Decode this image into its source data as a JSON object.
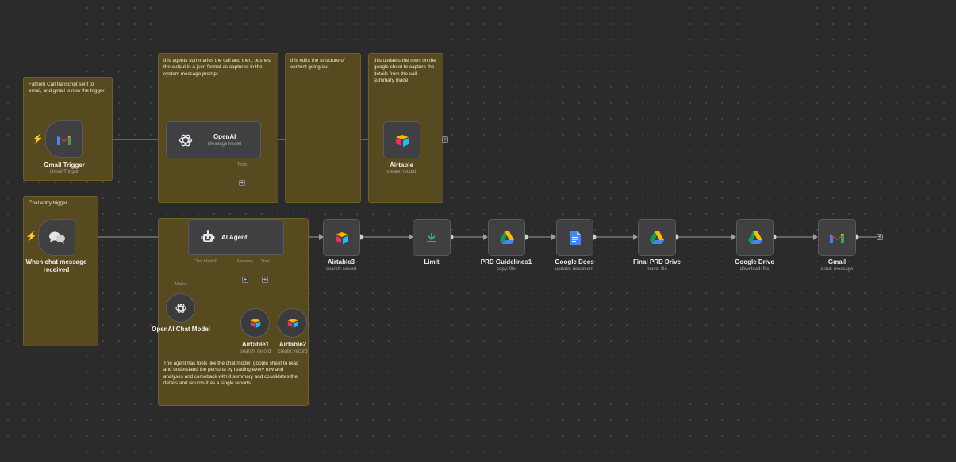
{
  "notes": {
    "fathom": "Fathom Call transcript sent to email, and gmail is now the trigger",
    "summarize": "this agents summaries the call and then, pushes the output in a json format as captured in the system message prompt",
    "edits": "this edits the structure of content going out",
    "updates": "this updates the rows on the google sheet to capture the details from the call summary made",
    "chat_entry": "Chat entry trigger",
    "agent_tools": "The agent has tools like the chat model, google sheet to read and understand the persona by reading every row and analyses and comeback with it summary and cosolidates the details and returns it as a single reports"
  },
  "nodes": {
    "gmail_trigger": {
      "title": "Gmail Trigger",
      "sub": "Gmail Trigger"
    },
    "openai": {
      "title": "OpenAI",
      "sub": "Message Model",
      "tools": "Tools"
    },
    "airtable": {
      "title": "Airtable",
      "sub": "create: record"
    },
    "chat_trigger": {
      "title": "When chat message received"
    },
    "ai_agent": {
      "title": "AI Agent",
      "chat_model": "Chat Model*",
      "memory": "Memory",
      "tool": "Tool"
    },
    "openai_chat": {
      "title": "OpenAI Chat Model",
      "model_label": "Model"
    },
    "airtable1": {
      "title": "Airtable1",
      "sub": "search: record"
    },
    "airtable2": {
      "title": "Airtable2",
      "sub": "create: record"
    },
    "airtable3": {
      "title": "Airtable3",
      "sub": "search: record"
    },
    "limit": {
      "title": "Limit"
    },
    "prd_guidelines": {
      "title": "PRD Guidelines1",
      "sub": "copy: file"
    },
    "google_docs": {
      "title": "Google Docs",
      "sub": "update: document"
    },
    "final_prd": {
      "title": "Final PRD Drive",
      "sub": "move: file"
    },
    "google_drive": {
      "title": "Google Drive",
      "sub": "download: file"
    },
    "gmail": {
      "title": "Gmail",
      "sub": "send: message"
    }
  },
  "icons": {
    "gmail": "gmail-icon",
    "openai": "openai-icon",
    "airtable": "airtable-icon",
    "chat": "chat-bubbles-icon",
    "robot": "robot-icon",
    "limit": "limit-icon",
    "drive": "google-drive-icon",
    "docs": "google-docs-icon",
    "trigger": "lightning-bolt-icon"
  },
  "colors": {
    "canvas": "#2b2b2c",
    "sticky": "#574a1f",
    "node": "#404042",
    "trigger_bolt": "#e8674a"
  }
}
